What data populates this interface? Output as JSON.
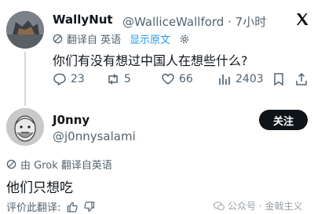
{
  "tweet": {
    "author_name": "WallyNut",
    "handle": "@WalliceWallford",
    "time_sep": "·",
    "time": "7小时",
    "translated_label": "翻译自 英语",
    "show_original": "显示原文",
    "text": "你们有没有想过中国人在想些什么?",
    "stats": {
      "replies": "23",
      "reposts": "5",
      "likes": "66",
      "views": "2403"
    }
  },
  "reply": {
    "author_name": "J0nny",
    "handle": "@j0nnysalami",
    "follow_label": "关注",
    "translated_label": "由 Grok 翻译自英语",
    "text": "他们只想吃",
    "rate_label": "评价此翻译:"
  },
  "watermark": {
    "text": "公众号 · 金戟主义"
  },
  "colors": {
    "accent": "#1d9bf0",
    "text": "#0f1419",
    "muted": "#536471"
  }
}
